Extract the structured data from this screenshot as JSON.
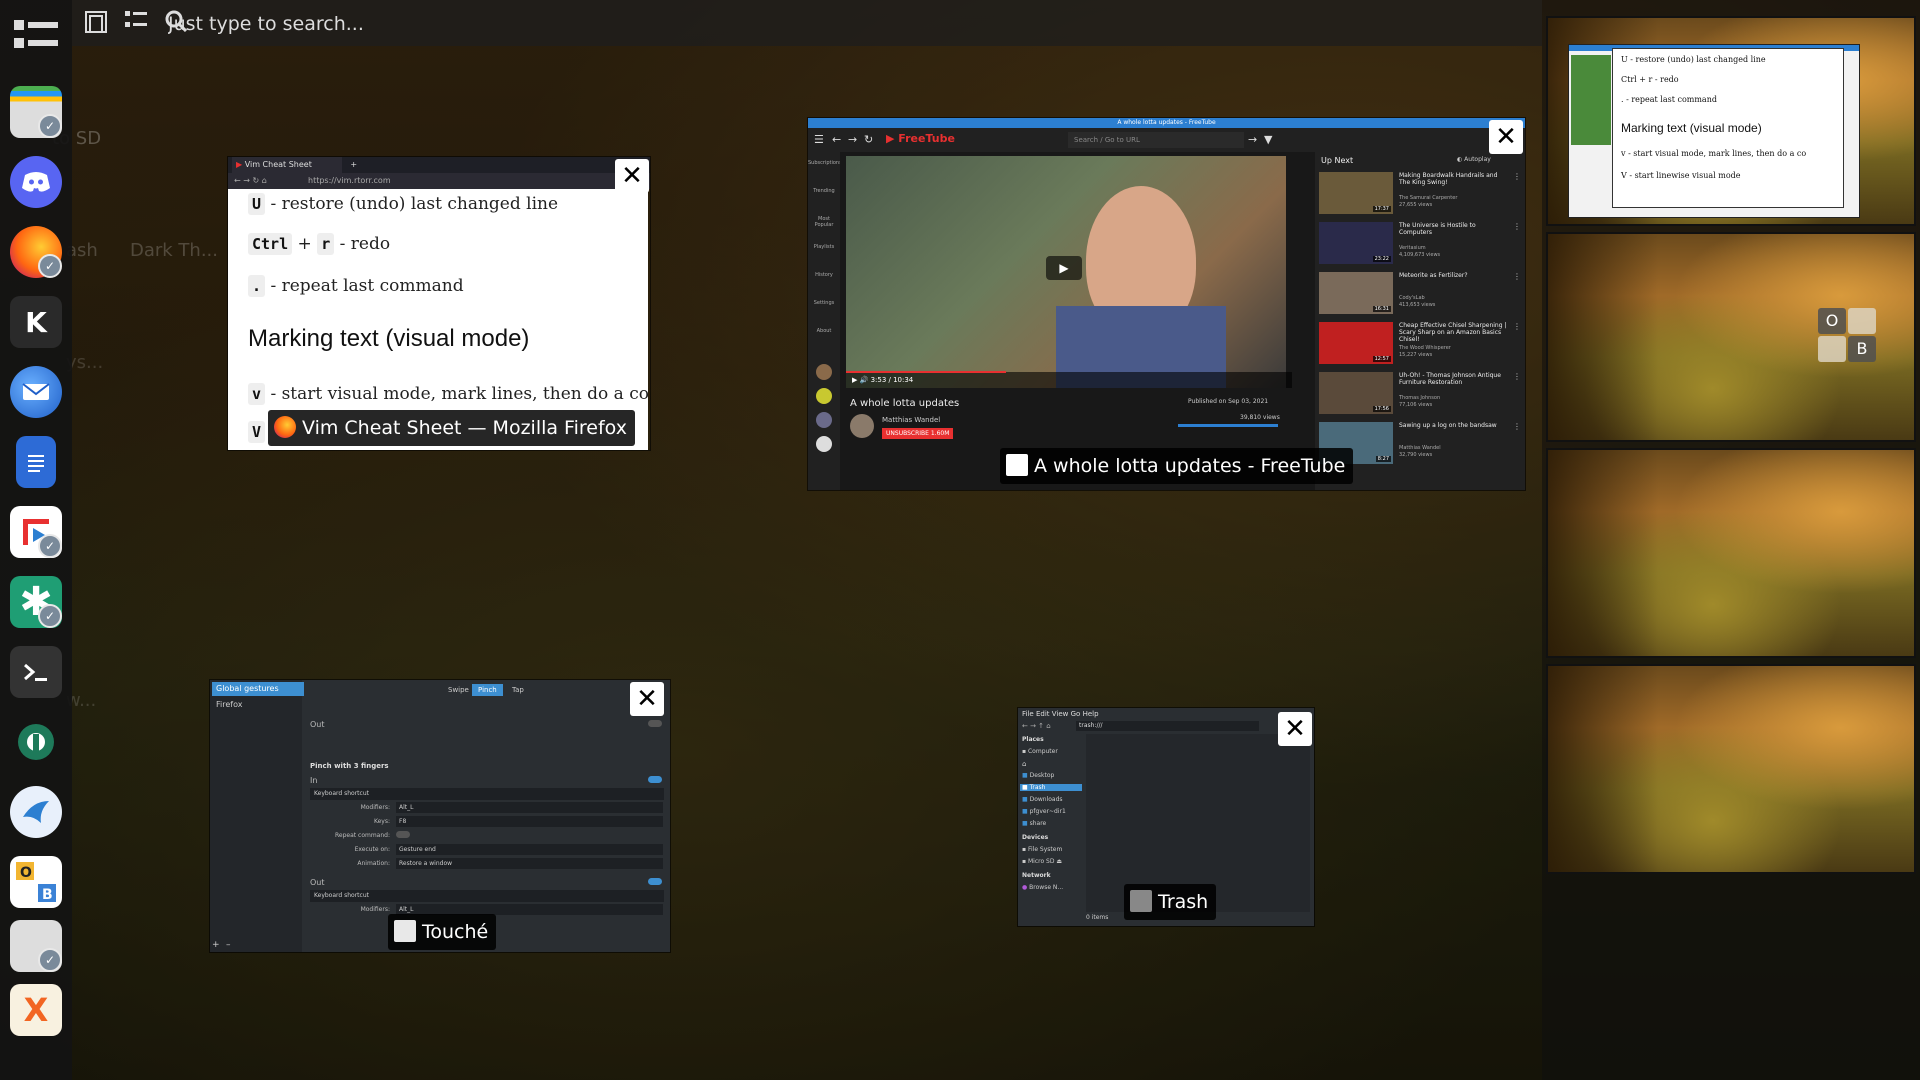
{
  "search": {
    "placeholder": "Just type to search..."
  },
  "dock": {
    "items": [
      {
        "name": "app-grid",
        "label": "Applications"
      },
      {
        "name": "removable-drive",
        "label": "Removable drive"
      },
      {
        "name": "discord",
        "label": "Discord"
      },
      {
        "name": "firefox",
        "label": "Firefox"
      },
      {
        "name": "kde-connect",
        "label": "KDE"
      },
      {
        "name": "thunderbird",
        "label": "Thunderbird"
      },
      {
        "name": "document",
        "label": "Document"
      },
      {
        "name": "freetube",
        "label": "FreeTube"
      },
      {
        "name": "asterisk-app",
        "label": "App"
      },
      {
        "name": "terminal",
        "label": "Terminal"
      },
      {
        "name": "extension",
        "label": "Extension"
      },
      {
        "name": "kdeconnect-bird",
        "label": "App"
      },
      {
        "name": "ob-app",
        "label": "O B"
      },
      {
        "name": "disk-utility",
        "label": "Disks"
      },
      {
        "name": "xournal",
        "label": "X"
      }
    ]
  },
  "windows": {
    "vim": {
      "label": "Vim Cheat Sheet — Mozilla Firefox",
      "tab_title": "Vim Cheat Sheet",
      "url": "https://vim.rtorr.com",
      "line1_key": "U",
      "line1_text": "- restore (undo) last changed line",
      "line2_key1": "Ctrl",
      "line2_plus": "+",
      "line2_key2": "r",
      "line2_text": "- redo",
      "line3_key": ".",
      "line3_text": "- repeat last command",
      "heading": "Marking text (visual mode)",
      "line4_key": "v",
      "line4_text": "- start visual mode, mark lines, then do a co",
      "line5_key": "V"
    },
    "freetube": {
      "label": "A whole lotta updates - FreeTube",
      "window_title": "A whole lotta updates - FreeTube",
      "brand": "FreeTube",
      "search_placeholder": "Search / Go to URL",
      "up_next": "Up Next",
      "autoplay": "Autoplay",
      "video_title": "A whole lotta updates",
      "channel": "Matthias Wandel",
      "unsubscribe": "UNSUBSCRIBE 1.60M",
      "published": "Published on Sep 03, 2021",
      "views": "39,810 views",
      "time": "3:53 / 10:34",
      "side_videos": [
        {
          "title": "Making Boardwalk Handrails and The King Swing!",
          "channel": "The Samurai Carpenter",
          "meta": "27,655 views",
          "duration": "17:37"
        },
        {
          "title": "The Universe is Hostile to Computers",
          "channel": "Veritasium",
          "meta": "4,109,673 views",
          "duration": "23:22"
        },
        {
          "title": "Meteorite as Fertilizer?",
          "channel": "Cody'sLab",
          "meta": "413,653 views",
          "duration": "16:31"
        },
        {
          "title": "Cheap Effective Chisel Sharpening | Scary Sharp on an Amazon Basics Chisel!",
          "channel": "The Wood Whisperer",
          "meta": "15,227 views",
          "duration": "12:57"
        },
        {
          "title": "Uh-Oh! - Thomas Johnson Antique Furniture Restoration",
          "channel": "Thomas Johnson",
          "meta": "77,106 views",
          "duration": "17:56"
        },
        {
          "title": "Sawing up a log on the bandsaw",
          "channel": "Matthias Wandel",
          "meta": "32,790 views",
          "duration": "8:27"
        }
      ],
      "nav_items": [
        "Subscriptions",
        "Trending",
        "Most Popular",
        "Playlists",
        "History",
        "Settings",
        "About"
      ]
    },
    "touche": {
      "label": "Touché",
      "sidebar_items": [
        "Global gestures",
        "Firefox"
      ],
      "tabs": [
        "Swipe",
        "Pinch",
        "Tap"
      ],
      "out_top": "Out",
      "section": "Pinch with 3 fingers",
      "in_label": "In",
      "action": "Keyboard shortcut",
      "modifiers_label": "Modifiers:",
      "modifiers_value": "Alt_L",
      "keys_label": "Keys:",
      "keys_value": "F8",
      "repeat_label": "Repeat command:",
      "execute_label": "Execute on:",
      "execute_value": "Gesture end",
      "animation_label": "Animation:",
      "animation_value": "Restore a window",
      "out_bottom": "Out",
      "action2": "Keyboard shortcut",
      "modifiers2_label": "Modifiers:",
      "modifiers2_value": "Alt_L",
      "add_btn": "+",
      "remove_btn": "–"
    },
    "trash": {
      "label": "Trash",
      "menu": [
        "File",
        "Edit",
        "View",
        "Go",
        "Help"
      ],
      "path": "trash:///",
      "places_header": "Places",
      "places": [
        "Computer",
        "Desktop",
        "Trash",
        "Downloads",
        "pfgver~dir1",
        "share"
      ],
      "devices_header": "Devices",
      "devices": [
        "File System",
        "Micro SD"
      ],
      "network_header": "Network",
      "network": [
        "Browse N..."
      ],
      "status": "0 items"
    }
  },
  "desktop_icons": [
    "to SD",
    "ash",
    "Dark Th...",
    "ys...",
    "w..."
  ],
  "workspaces": {
    "overlay_letters": [
      "O",
      "",
      "",
      "B"
    ],
    "mini_vim_lines": [
      "U - restore (undo) last changed line",
      "Ctrl + r - redo",
      ". - repeat last command",
      "Marking text (visual mode)",
      "v - start visual mode, mark lines, then do a co",
      "V - start linewise visual mode"
    ]
  },
  "close_symbol": "✕",
  "colors": {
    "accent": "#2c7fd1",
    "freetube_red": "#e83030",
    "dock_bg": "#141414"
  }
}
